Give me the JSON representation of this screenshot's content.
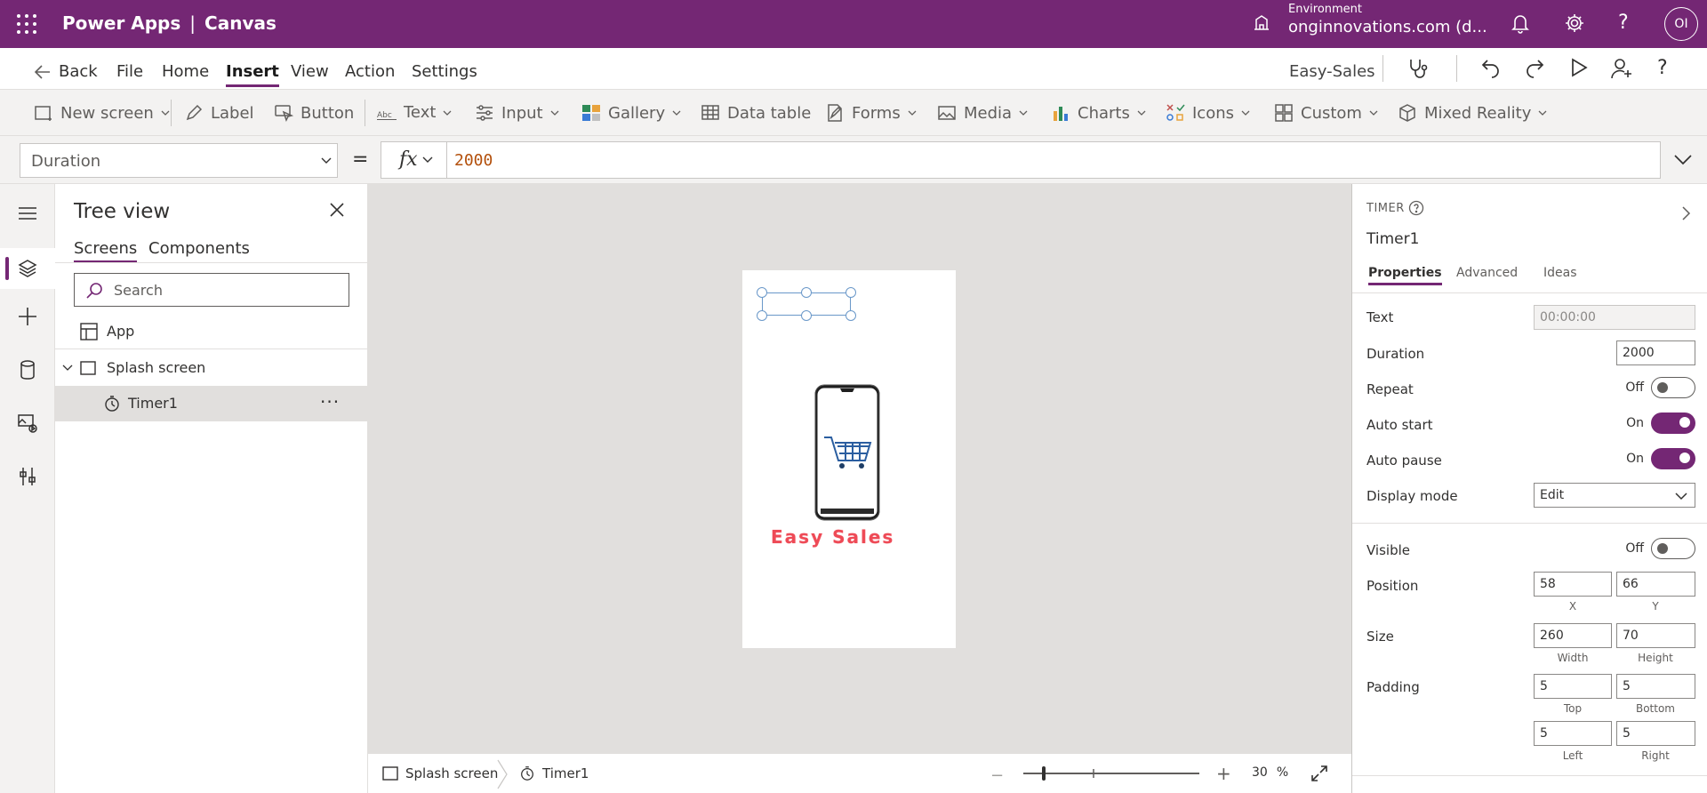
{
  "topbar": {
    "app_name": "Power Apps",
    "separator": "|",
    "app_type": "Canvas",
    "environment_label": "Environment",
    "environment_name": "onginnovations.com (d...",
    "avatar_initials": "OI",
    "bg_color": "#742774"
  },
  "menu": {
    "back": "Back",
    "items": [
      "File",
      "Home",
      "Insert",
      "View",
      "Action",
      "Settings"
    ],
    "active": "Insert",
    "app_title": "Easy-Sales"
  },
  "ribbon": {
    "new_screen": "New screen",
    "label": "Label",
    "button": "Button",
    "text": "Text",
    "input": "Input",
    "gallery": "Gallery",
    "data_table": "Data table",
    "forms": "Forms",
    "media": "Media",
    "charts": "Charts",
    "icons": "Icons",
    "custom": "Custom",
    "mixed_reality": "Mixed Reality"
  },
  "formula": {
    "property": "Duration",
    "equals": "=",
    "fx": "fx",
    "value": "2000"
  },
  "tree": {
    "title": "Tree view",
    "tabs": [
      "Screens",
      "Components"
    ],
    "search_placeholder": "Search",
    "app": "App",
    "screen": "Splash screen",
    "control": "Timer1",
    "more": "···"
  },
  "canvas": {
    "brand_text": "Easy Sales"
  },
  "statusbar": {
    "screen": "Splash screen",
    "control": "Timer1",
    "zoom_value": "30",
    "zoom_unit": "%"
  },
  "properties": {
    "type": "TIMER",
    "name": "Timer1",
    "tabs": [
      "Properties",
      "Advanced",
      "Ideas"
    ],
    "text_label": "Text",
    "text_value": "00:00:00",
    "duration_label": "Duration",
    "duration_value": "2000",
    "repeat_label": "Repeat",
    "repeat_state": "Off",
    "autostart_label": "Auto start",
    "autostart_state": "On",
    "autopause_label": "Auto pause",
    "autopause_state": "On",
    "displaymode_label": "Display mode",
    "displaymode_value": "Edit",
    "visible_label": "Visible",
    "visible_state": "Off",
    "position_label": "Position",
    "x_value": "58",
    "y_value": "66",
    "x_label": "X",
    "y_label": "Y",
    "size_label": "Size",
    "width_value": "260",
    "height_value": "70",
    "width_label": "Width",
    "height_label": "Height",
    "padding_label": "Padding",
    "pad_top": "5",
    "pad_bottom": "5",
    "pad_left": "5",
    "pad_right": "5",
    "top_label": "Top",
    "bottom_label": "Bottom",
    "left_label": "Left",
    "right_label": "Right"
  }
}
